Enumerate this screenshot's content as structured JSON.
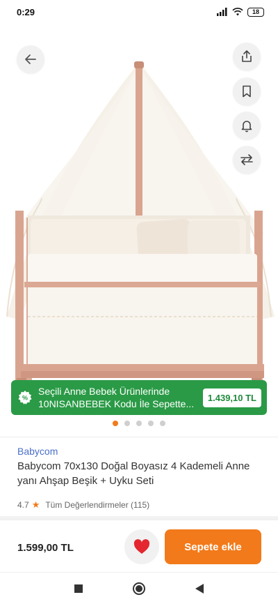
{
  "status": {
    "time": "0:29",
    "battery": "18"
  },
  "colors": {
    "accent": "#f27a1a",
    "promo_green": "#2a9a46",
    "brand_blue": "#4a6fc8",
    "heart_red": "#e3262f"
  },
  "header_actions": {
    "back_icon": "arrow-left-icon",
    "share_icon": "share-icon",
    "bookmark_icon": "bookmark-icon",
    "notify_icon": "bell-icon",
    "compare_icon": "compare-arrows-icon"
  },
  "promo": {
    "line1": "Seçili Anne Bebek Ürünlerinde",
    "line2": "10NISANBEBEK Kodu İle Sepette...",
    "price": "1.439,10 TL",
    "icon": "gear-badge-icon"
  },
  "carousel": {
    "active_index": 0,
    "count": 5
  },
  "product": {
    "brand": "Babycom",
    "title": "Babycom 70x130 Doğal Boyasız 4 Kademeli Anne yanı Ahşap Beşik + Uyku Seti",
    "rating": "4.7",
    "reviews_label": "Tüm Değerlendirmeler (115)"
  },
  "bottom": {
    "price": "1.599,00 TL",
    "add_to_cart": "Sepete ekle",
    "favorite_icon": "heart-icon"
  }
}
